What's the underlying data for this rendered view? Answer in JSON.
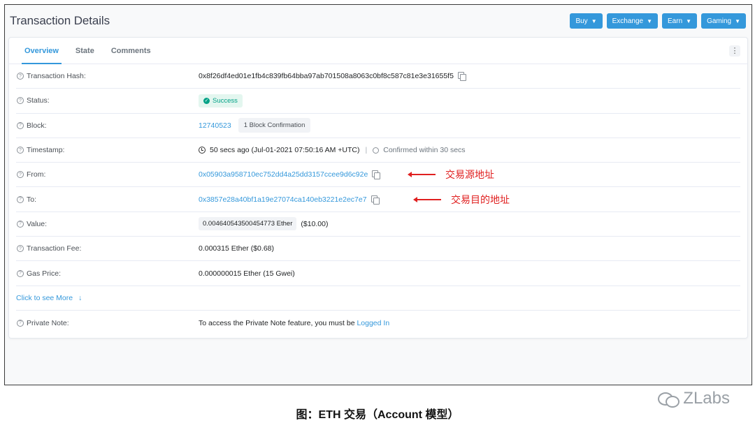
{
  "page": {
    "title": "Transaction Details"
  },
  "header_buttons": [
    {
      "label": "Buy"
    },
    {
      "label": "Exchange"
    },
    {
      "label": "Earn"
    },
    {
      "label": "Gaming"
    }
  ],
  "tabs": [
    {
      "label": "Overview",
      "active": true
    },
    {
      "label": "State",
      "active": false
    },
    {
      "label": "Comments",
      "active": false
    }
  ],
  "details": {
    "hash": {
      "label": "Transaction Hash:",
      "value": "0x8f26df4ed01e1fb4c839fb64bba97ab701508a8063c0bf8c587c81e3e31655f5"
    },
    "status": {
      "label": "Status:",
      "value": "Success"
    },
    "block": {
      "label": "Block:",
      "value": "12740523",
      "confirmations": "1 Block Confirmation"
    },
    "timestamp": {
      "label": "Timestamp:",
      "value": "50 secs ago (Jul-01-2021 07:50:16 AM +UTC)",
      "separator": "|",
      "confirmed": "Confirmed within 30 secs"
    },
    "from": {
      "label": "From:",
      "value": "0x05903a958710ec752dd4a25dd3157ccee9d6c92e"
    },
    "to": {
      "label": "To:",
      "value": "0x3857e28a40bf1a19e27074ca140eb3221e2ec7e7"
    },
    "value": {
      "label": "Value:",
      "amount": "0.004640543500454773 Ether",
      "usd": "($10.00)"
    },
    "fee": {
      "label": "Transaction Fee:",
      "value": "0.000315 Ether ($0.68)"
    },
    "gas": {
      "label": "Gas Price:",
      "value": "0.000000015 Ether (15 Gwei)"
    },
    "see_more": {
      "label": "Click to see More",
      "arrow": "↓"
    },
    "note": {
      "label": "Private Note:",
      "text": "To access the Private Note feature, you must be ",
      "link": "Logged In"
    }
  },
  "annotations": {
    "from": "交易源地址",
    "to": "交易目的地址"
  },
  "caption": "图：ETH 交易（Account 模型）",
  "watermark": "ZLabs",
  "colors": {
    "accent": "#3498db",
    "success": "#00a186",
    "annotation": "#e02020"
  }
}
